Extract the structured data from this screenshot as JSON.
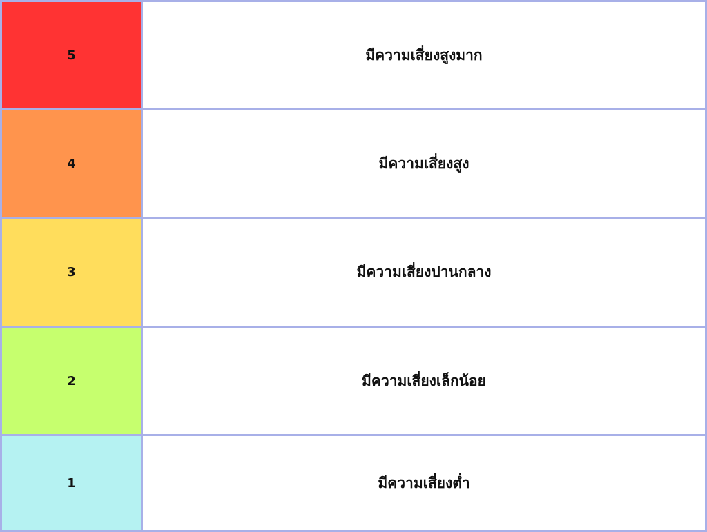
{
  "risk_levels": [
    {
      "level": "5",
      "label": "มีความเสี่ยงสูงมาก",
      "color": "#ff3333"
    },
    {
      "level": "4",
      "label": "มีความเสี่ยงสูง",
      "color": "#ff944d"
    },
    {
      "level": "3",
      "label": "มีความเสี่ยงปานกลาง",
      "color": "#ffdd5c"
    },
    {
      "level": "2",
      "label": "มีความเสี่ยงเล็กน้อย",
      "color": "#c6ff6e"
    },
    {
      "level": "1",
      "label": "มีความเสี่ยงต่ำ",
      "color": "#b5f2f2"
    }
  ],
  "colors": {
    "grid_border": "#a8b0e8",
    "description_background": "#ffffff",
    "text": "#111111"
  }
}
